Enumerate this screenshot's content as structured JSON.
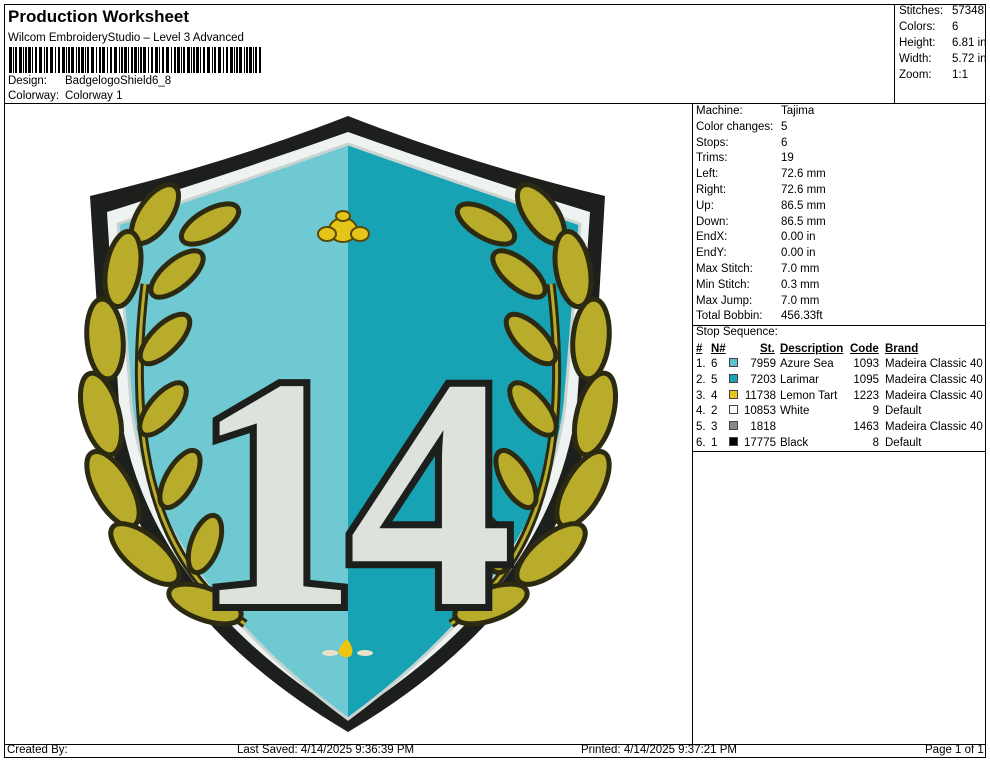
{
  "header": {
    "title": "Production Worksheet",
    "subtitle": "Wilcom EmbroideryStudio – Level 3 Advanced",
    "design_label": "Design:",
    "design_value": "BadgelogoShield6_8",
    "colorway_label": "Colorway:",
    "colorway_value": "Colorway 1"
  },
  "stats": [
    {
      "k": "Stitches:",
      "v": "57348"
    },
    {
      "k": "Colors:",
      "v": "6"
    },
    {
      "k": "Height:",
      "v": "6.81 in"
    },
    {
      "k": "Width:",
      "v": "5.72 in"
    },
    {
      "k": "Zoom:",
      "v": "1:1"
    }
  ],
  "info": [
    {
      "k": "Machine:",
      "v": "Tajima"
    },
    {
      "k": "Color changes:",
      "v": "5"
    },
    {
      "k": "Stops:",
      "v": "6"
    },
    {
      "k": "Trims:",
      "v": "19"
    },
    {
      "k": "Left:",
      "v": "72.6 mm"
    },
    {
      "k": "Right:",
      "v": "72.6 mm"
    },
    {
      "k": "Up:",
      "v": "86.5 mm"
    },
    {
      "k": "Down:",
      "v": "86.5 mm"
    },
    {
      "k": "EndX:",
      "v": "0.00 in"
    },
    {
      "k": "EndY:",
      "v": "0.00 in"
    },
    {
      "k": "Max Stitch:",
      "v": "7.0 mm"
    },
    {
      "k": "Min Stitch:",
      "v": "0.3 mm"
    },
    {
      "k": "Max Jump:",
      "v": "7.0 mm"
    },
    {
      "k": "Total Bobbin:",
      "v": "456.33ft"
    }
  ],
  "sequence": {
    "title": "Stop Sequence:",
    "headers": {
      "num": "#",
      "n": "N#",
      "st": "St.",
      "desc": "Description",
      "code": "Code",
      "brand": "Brand"
    },
    "rows": [
      {
        "num": "1.",
        "n": "6",
        "color": "#5bc0cf",
        "st": "7959",
        "desc": "Azure Sea",
        "code": "1093",
        "brand": "Madeira Classic 40"
      },
      {
        "num": "2.",
        "n": "5",
        "color": "#1aa3b5",
        "st": "7203",
        "desc": "Larimar",
        "code": "1095",
        "brand": "Madeira Classic 40"
      },
      {
        "num": "3.",
        "n": "4",
        "color": "#e3c51c",
        "st": "11738",
        "desc": "Lemon Tart",
        "code": "1223",
        "brand": "Madeira Classic 40"
      },
      {
        "num": "4.",
        "n": "2",
        "color": "#ffffff",
        "st": "10853",
        "desc": "White",
        "code": "9",
        "brand": "Default"
      },
      {
        "num": "5.",
        "n": "3",
        "color": "#8a8a8a",
        "st": "1818",
        "desc": "",
        "code": "1463",
        "brand": "Madeira Classic 40"
      },
      {
        "num": "6.",
        "n": "1",
        "color": "#000000",
        "st": "17775",
        "desc": "Black",
        "code": "8",
        "brand": "Default"
      }
    ]
  },
  "design_text": "14",
  "footer": {
    "created": "Created By:",
    "saved": "Last Saved: 4/14/2025 9:36:39 PM",
    "printed": "Printed: 4/14/2025 9:37:21 PM",
    "page": "Page 1 of 1"
  },
  "colors": {
    "shield_outline": "#1d1f1c",
    "shield_white": "#eef2f1",
    "teal_light": "#6ec9d3",
    "teal_dark": "#17a3b3",
    "leaf": "#b9ac2a",
    "leaf_dark": "#2d2a12",
    "numeral": "#dde3dc"
  }
}
